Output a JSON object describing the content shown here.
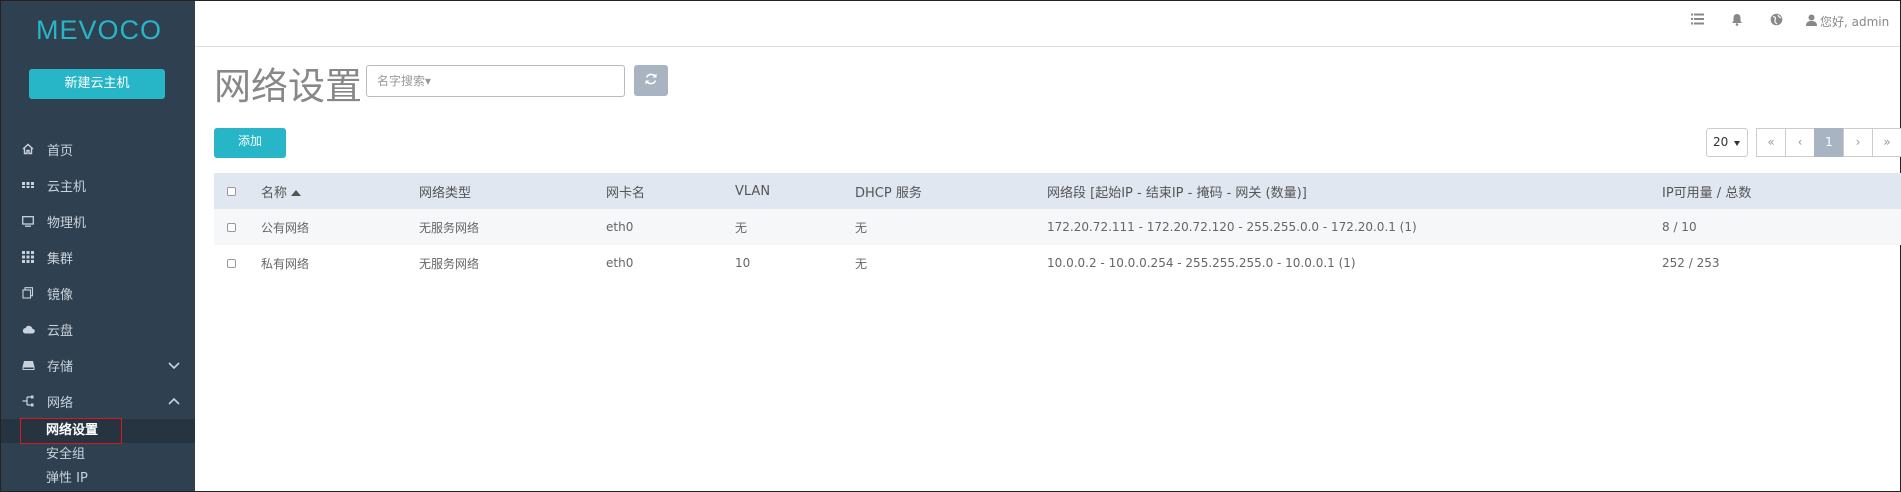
{
  "sidebar": {
    "logo": "MEVOCO",
    "new_vm_button": "新建云主机",
    "items": [
      {
        "label": "首页",
        "icon": "home-icon"
      },
      {
        "label": "云主机",
        "icon": "vm-icon"
      },
      {
        "label": "物理机",
        "icon": "monitor-icon"
      },
      {
        "label": "集群",
        "icon": "grid-icon"
      },
      {
        "label": "镜像",
        "icon": "image-icon"
      },
      {
        "label": "云盘",
        "icon": "cloud-icon"
      },
      {
        "label": "存储",
        "icon": "storage-icon"
      },
      {
        "label": "网络",
        "icon": "network-icon"
      }
    ],
    "subitems": [
      {
        "label": "网络设置",
        "active": true
      },
      {
        "label": "安全组"
      },
      {
        "label": "弹性 IP"
      }
    ]
  },
  "topbar": {
    "icons": [
      "list-icon",
      "bell-icon",
      "globe-icon",
      "user-icon"
    ],
    "user_text": "您好, admin"
  },
  "main": {
    "title": "网络设置",
    "search_placeholder": "名字搜索▾",
    "add_button": "添加",
    "page_size": "20",
    "pager": [
      "«",
      "‹",
      "1",
      "›",
      "»"
    ],
    "current_page": "1"
  },
  "table": {
    "columns": [
      "名称",
      "网络类型",
      "网卡名",
      "VLAN",
      "DHCP 服务",
      "网络段 [起始IP - 结束IP - 掩码 - 网关 (数量)]",
      "IP可用量 / 总数"
    ],
    "rows": [
      [
        "公有网络",
        "无服务网络",
        "eth0",
        "无",
        "无",
        "172.20.72.111 - 172.20.72.120 - 255.255.0.0 - 172.20.0.1 (1)",
        "8 / 10"
      ],
      [
        "私有网络",
        "无服务网络",
        "eth0",
        "10",
        "无",
        "10.0.0.2 - 10.0.0.254 - 255.255.255.0 - 10.0.0.1 (1)",
        "252 / 253"
      ]
    ]
  },
  "colors": {
    "accent": "#27b6c8",
    "sidebar_bg": "#2f4050",
    "header_bg": "#e0e7f1",
    "highlight": "#d9191d"
  }
}
